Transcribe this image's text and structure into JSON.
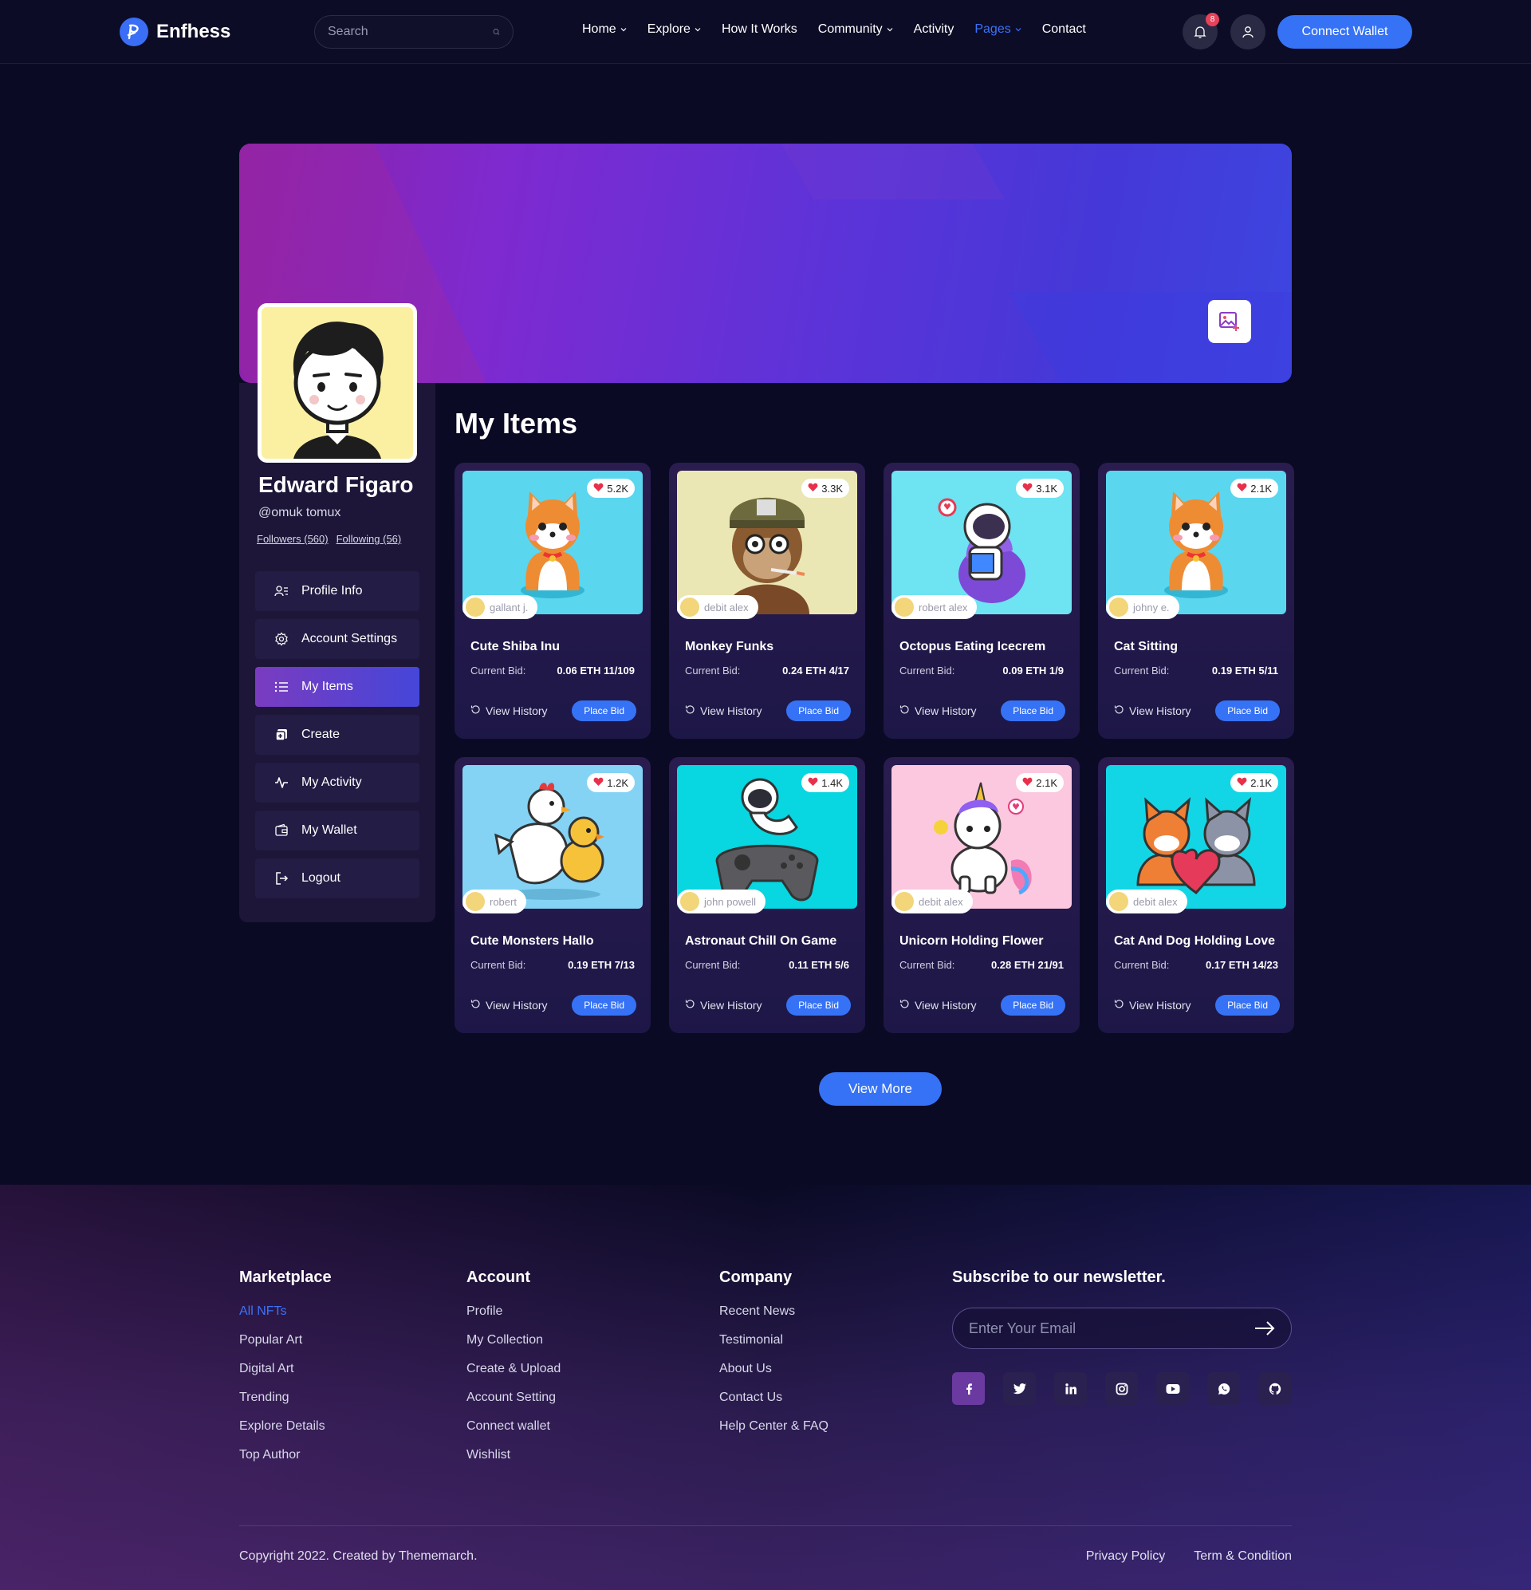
{
  "brand": {
    "name": "Enfhess",
    "accent": "#3672f6"
  },
  "search": {
    "placeholder": "Search"
  },
  "nav": {
    "items": [
      {
        "label": "Home",
        "dropdown": true
      },
      {
        "label": "Explore",
        "dropdown": true
      },
      {
        "label": "How It Works",
        "dropdown": false
      },
      {
        "label": "Community",
        "dropdown": true
      },
      {
        "label": "Activity",
        "dropdown": false
      },
      {
        "label": "Pages",
        "dropdown": true,
        "active": true
      },
      {
        "label": "Contact",
        "dropdown": false
      }
    ]
  },
  "header": {
    "notification_count": "8",
    "connect_label": "Connect Wallet"
  },
  "profile": {
    "name": "Edward Figaro",
    "handle": "@omuk tomux",
    "followers": "Followers (560)",
    "following": "Following (56)"
  },
  "menu": [
    {
      "label": "Profile Info",
      "icon": "user-list-icon"
    },
    {
      "label": "Account Settings",
      "icon": "gear-icon"
    },
    {
      "label": "My Items",
      "icon": "list-icon",
      "active": true
    },
    {
      "label": "Create",
      "icon": "create-icon"
    },
    {
      "label": "My Activity",
      "icon": "activity-icon"
    },
    {
      "label": "My Wallet",
      "icon": "wallet-icon"
    },
    {
      "label": "Logout",
      "icon": "logout-icon"
    }
  ],
  "main": {
    "title": "My Items",
    "bid_label": "Current Bid:",
    "history_label": "View History",
    "bid_button": "Place Bid",
    "view_more": "View More",
    "items": [
      {
        "title": "Cute Shiba Inu",
        "likes": "5.2K",
        "owner": "gallant j.",
        "bid": "0.06 ETH 11/109",
        "bg": "#5ad6ef",
        "art": "shiba-art"
      },
      {
        "title": "Monkey Funks",
        "likes": "3.3K",
        "owner": "debit alex",
        "bid": "0.24 ETH 4/17",
        "bg": "#ebe7b4",
        "art": "monkey-art"
      },
      {
        "title": "Octopus Eating Icecrem",
        "likes": "3.1K",
        "owner": "robert alex",
        "bid": "0.09 ETH 1/9",
        "bg": "#6ee3f2",
        "art": "astronaut-reading-art"
      },
      {
        "title": "Cat Sitting",
        "likes": "2.1K",
        "owner": "johny e.",
        "bid": "0.19 ETH 5/11",
        "bg": "#5ad6ef",
        "art": "shiba-art"
      },
      {
        "title": "Cute Monsters Hallo",
        "likes": "1.2K",
        "owner": "robert",
        "bid": "0.19 ETH 7/13",
        "bg": "#84d3f5",
        "art": "chickens-art"
      },
      {
        "title": "Astronaut Chill On Game",
        "likes": "1.4K",
        "owner": "john powell",
        "bid": "0.11 ETH 5/6",
        "bg": "#08d6e0",
        "art": "astronaut-game-art"
      },
      {
        "title": "Unicorn Holding Flower",
        "likes": "2.1K",
        "owner": "debit alex",
        "bid": "0.28 ETH 21/91",
        "bg": "#fbc8df",
        "art": "unicorn-art"
      },
      {
        "title": "Cat And Dog Holding Love",
        "likes": "2.1K",
        "owner": "debit alex",
        "bid": "0.17 ETH 14/23",
        "bg": "#12d6e6",
        "art": "cat-dog-art"
      }
    ]
  },
  "footer": {
    "marketplace": {
      "title": "Marketplace",
      "links": [
        "All NFTs",
        "Popular Art",
        "Digital Art",
        "Trending",
        "Explore Details",
        "Top Author"
      ]
    },
    "account": {
      "title": "Account",
      "links": [
        "Profile",
        "My Collection",
        "Create & Upload",
        "Account Setting",
        "Connect wallet",
        "Wishlist"
      ]
    },
    "company": {
      "title": "Company",
      "links": [
        "Recent News",
        "Testimonial",
        "About Us",
        "Contact Us",
        "Help Center & FAQ"
      ]
    },
    "newsletter": {
      "title": "Subscribe to our newsletter.",
      "placeholder": "Enter Your Email"
    },
    "socials": [
      "facebook-icon",
      "twitter-icon",
      "linkedin-icon",
      "instagram-icon",
      "youtube-icon",
      "whatsapp-icon",
      "github-icon"
    ],
    "copyright": "Copyright 2022. Created by Thememarch.",
    "privacy": "Privacy Policy",
    "terms": "Term & Condition"
  }
}
